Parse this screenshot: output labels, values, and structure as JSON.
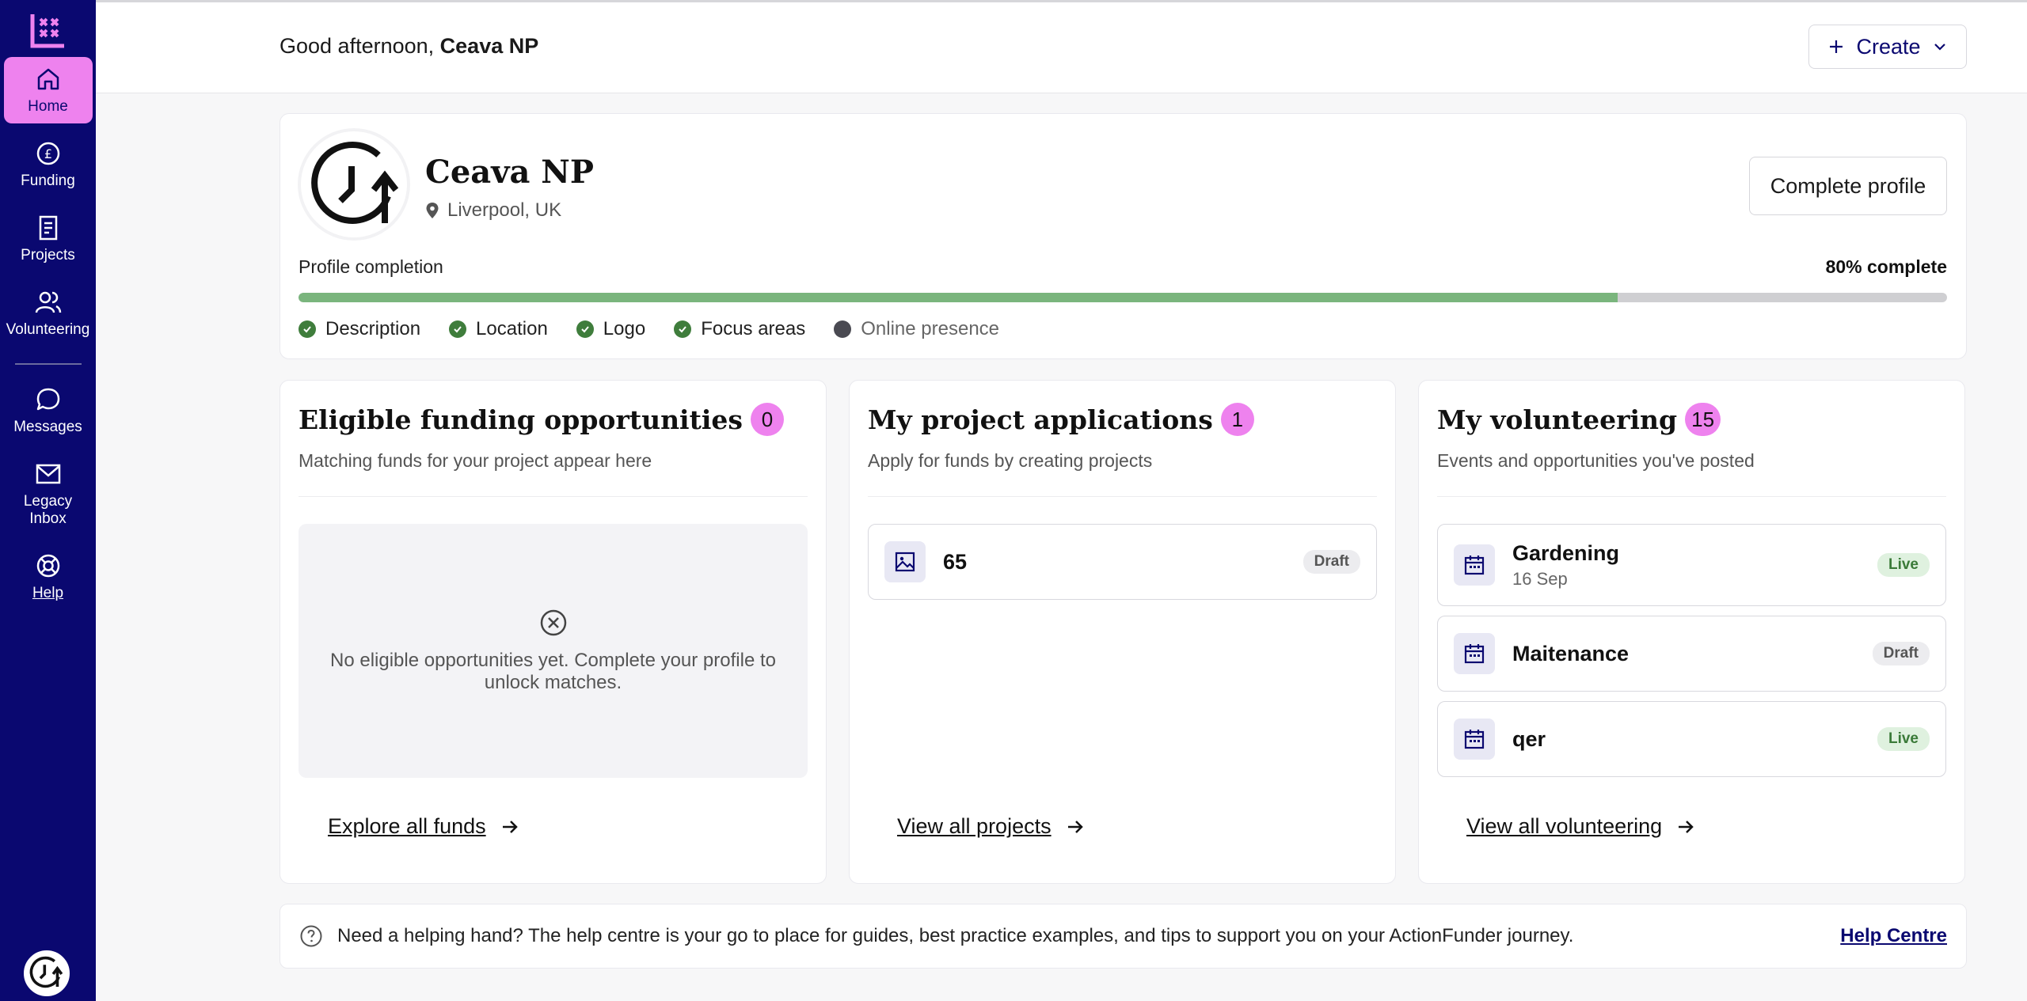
{
  "sidebar": {
    "items": [
      {
        "label": "Home",
        "icon": "home-icon",
        "active": true
      },
      {
        "label": "Funding",
        "icon": "pound-icon"
      },
      {
        "label": "Projects",
        "icon": "document-icon"
      },
      {
        "label": "Volunteering",
        "icon": "users-icon"
      },
      {
        "label": "Messages",
        "icon": "chat-icon"
      },
      {
        "label": "Legacy Inbox",
        "icon": "mail-icon"
      },
      {
        "label": "Help",
        "icon": "lifebuoy-icon"
      }
    ]
  },
  "header": {
    "greeting": "Good afternoon,",
    "user_name": "Ceava NP",
    "create_label": "Create"
  },
  "profile": {
    "name": "Ceava NP",
    "location": "Liverpool, UK",
    "complete_button": "Complete profile",
    "completion_label": "Profile completion",
    "completion_value": "80% complete",
    "completion_fraction": 0.8,
    "checks": [
      {
        "label": "Description",
        "done": true
      },
      {
        "label": "Location",
        "done": true
      },
      {
        "label": "Logo",
        "done": true
      },
      {
        "label": "Focus areas",
        "done": true
      },
      {
        "label": "Online presence",
        "done": false
      }
    ]
  },
  "funding": {
    "title": "Eligible funding opportunities",
    "count": "0",
    "subtitle": "Matching funds for your project appear here",
    "empty_message": "No eligible opportunities yet. Complete your profile to unlock matches.",
    "link": "Explore all funds"
  },
  "projects": {
    "title": "My project applications",
    "count": "1",
    "subtitle": "Apply for funds by creating projects",
    "items": [
      {
        "title": "65",
        "status": "Draft"
      }
    ],
    "link": "View all projects"
  },
  "volunteering": {
    "title": "My volunteering",
    "count": "15",
    "subtitle": "Events and opportunities you've posted",
    "items": [
      {
        "title": "Gardening",
        "date": "16 Sep",
        "status": "Live"
      },
      {
        "title": "Maitenance",
        "date": "",
        "status": "Draft"
      },
      {
        "title": "qer",
        "date": "",
        "status": "Live"
      }
    ],
    "link": "View all volunteering"
  },
  "help_bar": {
    "text": "Need a helping hand? The help centre is your go to place for guides, best practice examples, and tips to support you on your ActionFunder journey.",
    "link": "Help Centre"
  },
  "colors": {
    "sidebar_bg": "#0a0870",
    "accent_pink": "#ee82ee",
    "progress_fill": "#7ab57d",
    "check_green": "#3f7d3c"
  }
}
